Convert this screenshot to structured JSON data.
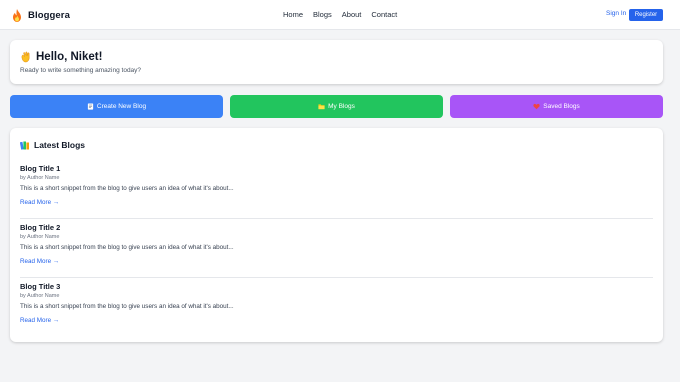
{
  "navbar": {
    "brand_name": "Bloggera",
    "links": [
      "Home",
      "Blogs",
      "About",
      "Contact"
    ],
    "signin_label": "Sign In",
    "register_label": "Register"
  },
  "greeting": {
    "title": "Hello, Niket!",
    "subtitle": "Ready to write something amazing today?"
  },
  "actions": {
    "create_label": "Create New Blog",
    "myblogs_label": "My Blogs",
    "saved_label": "Saved Blogs"
  },
  "latest": {
    "heading": "Latest Blogs",
    "blogs": [
      {
        "title": "Blog Title 1",
        "author": "by Author Name",
        "snippet": "This is a short snippet from the blog to give users an idea of what it's about...",
        "read_more": "Read More →"
      },
      {
        "title": "Blog Title 2",
        "author": "by Author Name",
        "snippet": "This is a short snippet from the blog to give users an idea of what it's about...",
        "read_more": "Read More →"
      },
      {
        "title": "Blog Title 3",
        "author": "by Author Name",
        "snippet": "This is a short snippet from the blog to give users an idea of what it's about...",
        "read_more": "Read More →"
      }
    ]
  },
  "colors": {
    "primary": "#2563eb",
    "create": "#3b82f6",
    "myblogs": "#22c55e",
    "saved": "#a855f7",
    "background": "#f3f4f6"
  },
  "icons": {
    "brand": "flame-logo-icon",
    "greeting": "waving-hand-icon",
    "create": "memo-icon",
    "myblogs": "folder-icon",
    "saved": "heart-icon",
    "latest": "books-icon"
  }
}
